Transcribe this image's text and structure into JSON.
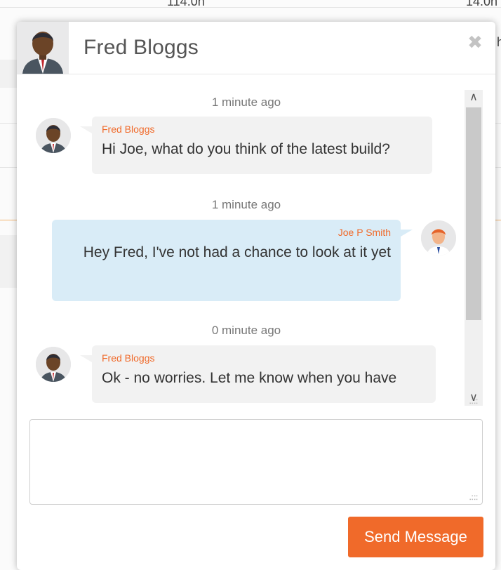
{
  "background": {
    "top_text_left": "114.0h",
    "top_text_right": "14.0h",
    "side_letter": "h"
  },
  "chat": {
    "title": "Fred Bloggs",
    "close_icon": "close-icon",
    "messages": [
      {
        "timestamp": "1 minute ago",
        "sender": "Fred Bloggs",
        "text": "Hi Joe, what do you think of the latest build?",
        "direction": "incoming"
      },
      {
        "timestamp": "1 minute ago",
        "sender": "Joe P Smith",
        "text": "Hey Fred, I've not had a chance to look at it yet",
        "direction": "outgoing"
      },
      {
        "timestamp": "0 minute ago",
        "sender": "Fred Bloggs",
        "text": "Ok - no worries. Let me know when you have",
        "direction": "incoming"
      }
    ],
    "input": {
      "value": "",
      "placeholder": ""
    },
    "send_label": "Send Message",
    "colors": {
      "accent": "#f06a2a",
      "outgoing_bubble": "#d9ecf7",
      "incoming_bubble": "#f2f2f2"
    }
  }
}
